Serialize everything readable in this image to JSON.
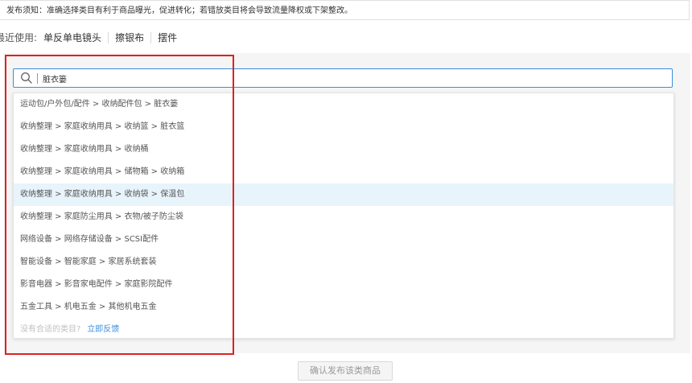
{
  "notice": {
    "text": "发布须知：准确选择类目有利于商品曝光，促进转化；若错放类目将会导致流量降权或下架整改。"
  },
  "recent": {
    "label": "最近使用:",
    "items": [
      "单反单电镜头",
      "擦银布",
      "摆件"
    ]
  },
  "search": {
    "value": "脏衣篓",
    "icon": "search-icon",
    "border_color": "#3c8ddc"
  },
  "results": [
    "运动包/户外包/配件 > 收纳配件包 > 脏衣篓",
    "收纳整理 > 家庭收纳用具 > 收纳篮 > 脏衣篮",
    "收纳整理 > 家庭收纳用具 > 收纳桶",
    "收纳整理 > 家庭收纳用具 > 储物箱 > 收纳箱",
    "收纳整理 > 家庭收纳用具 > 收纳袋 > 保温包",
    "收纳整理 > 家庭防尘用具 > 衣物/被子防尘袋",
    "网络设备 > 网络存储设备 > SCSI配件",
    "智能设备 > 智能家庭 > 家居系统套装",
    "影音电器 > 影音家电配件 > 家庭影院配件",
    "五金工具 > 机电五金 > 其他机电五金"
  ],
  "highlight_index": 4,
  "highlight_color": "#e8f4fb",
  "feedback": {
    "question": "没有合适的类目?",
    "link": "立即反馈",
    "link_color": "#3c8ddc"
  },
  "annotation_color": "#e02020",
  "confirm_button": {
    "label": "确认发布该类商品"
  }
}
